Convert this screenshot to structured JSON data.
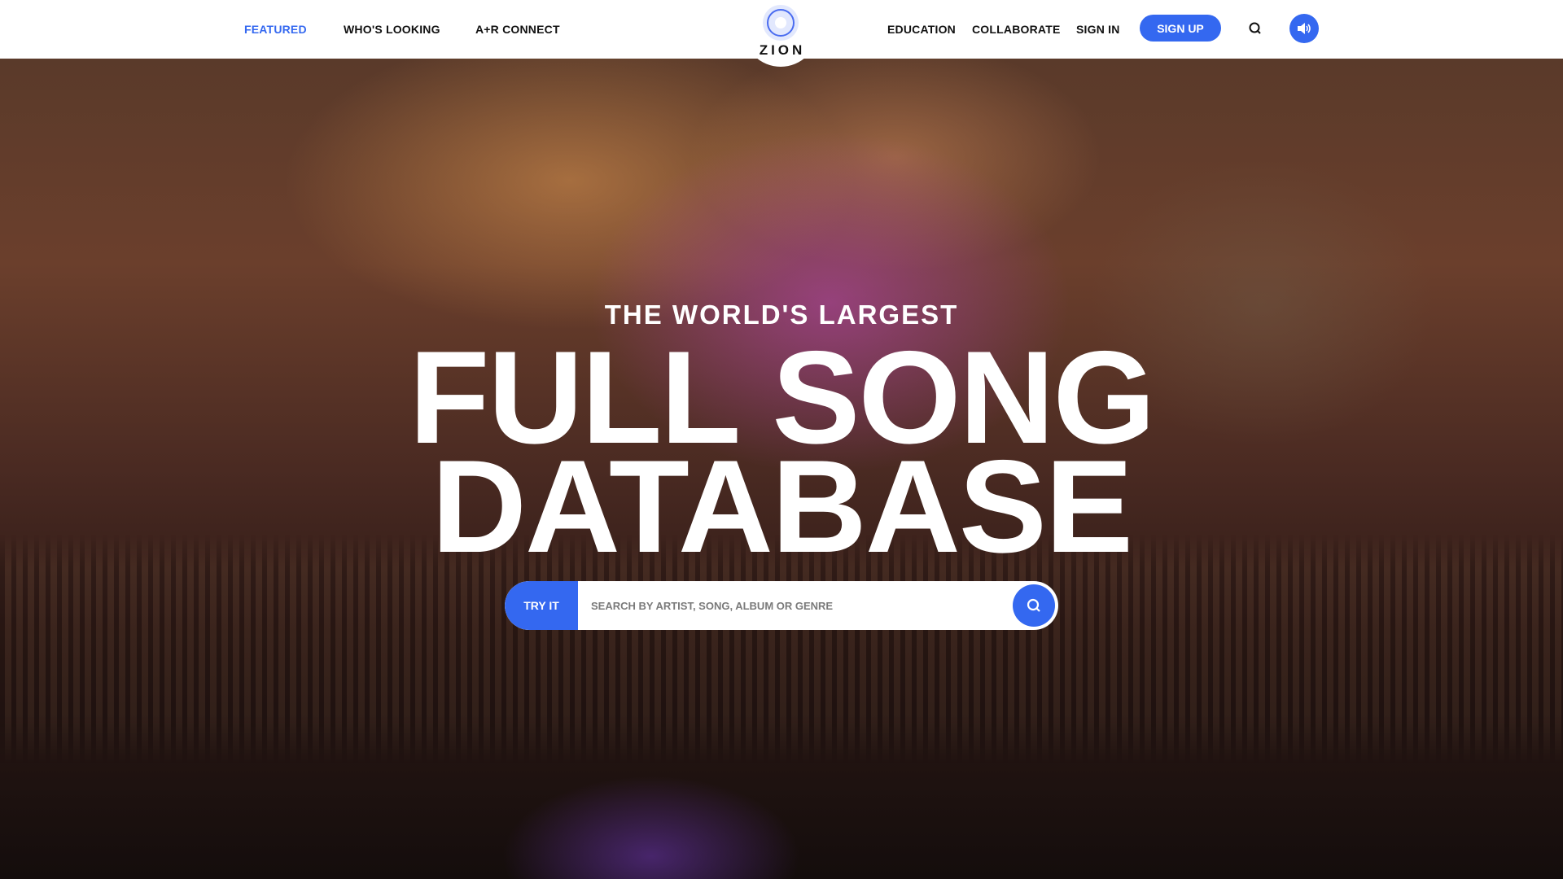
{
  "nav": {
    "left": [
      {
        "label": "FEATURED",
        "active": true
      },
      {
        "label": "WHO'S LOOKING"
      },
      {
        "label": "A+R CONNECT"
      }
    ],
    "right": [
      {
        "label": "EDUCATION"
      },
      {
        "label": "COLLABORATE"
      },
      {
        "label": "SIGN IN"
      }
    ],
    "signup": "SIGN UP",
    "logo": "ZION",
    "search_icon": "search-icon",
    "sound_icon": "speaker-icon"
  },
  "hero": {
    "subtitle": "THE WORLD'S LARGEST",
    "line1": "FULL SONG",
    "line2": "DATABASE",
    "try": "TRY IT",
    "placeholder": "SEARCH BY ARTIST, SONG, ALBUM OR GENRE"
  },
  "colors": {
    "accent": "#3468f0"
  }
}
